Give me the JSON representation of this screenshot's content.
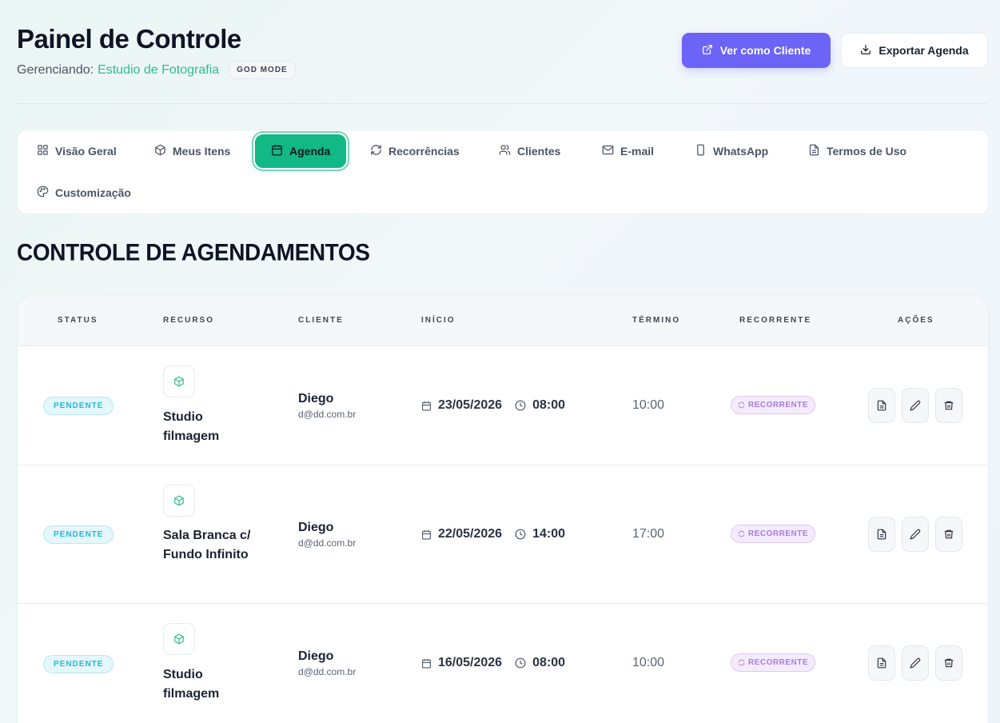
{
  "header": {
    "title": "Painel de Controle",
    "managing_label": "Gerenciando:",
    "studio_name": "Estudio de Fotografia",
    "mode_badge": "GOD MODE"
  },
  "actions": {
    "view_as_client": "Ver como Cliente",
    "export_schedule": "Exportar Agenda"
  },
  "tabs": [
    {
      "label": "Visão Geral",
      "icon": "grid-icon"
    },
    {
      "label": "Meus Itens",
      "icon": "box-icon"
    },
    {
      "label": "Agenda",
      "icon": "calendar-icon",
      "active": true
    },
    {
      "label": "Recorrências",
      "icon": "refresh-icon"
    },
    {
      "label": "Clientes",
      "icon": "users-icon"
    },
    {
      "label": "E-mail",
      "icon": "mail-icon"
    },
    {
      "label": "WhatsApp",
      "icon": "phone-icon"
    },
    {
      "label": "Termos de Uso",
      "icon": "document-icon"
    },
    {
      "label": "Customização",
      "icon": "palette-icon"
    }
  ],
  "section_title": "CONTROLE DE AGENDAMENTOS",
  "table": {
    "headers": {
      "status": "STATUS",
      "resource": "RECURSO",
      "client": "CLIENTE",
      "start": "INÍCIO",
      "end": "TÉRMINO",
      "recurring": "RECORRENTE",
      "actions": "AÇÕES"
    },
    "rows": [
      {
        "status": "PENDENTE",
        "resource": "Studio filmagem",
        "client": "Diego",
        "email": "d@dd.com.br",
        "date": "23/05/2026",
        "time": "08:00",
        "end": "10:00",
        "recurring": "RECORRENTE"
      },
      {
        "status": "PENDENTE",
        "resource": "Sala Branca c/ Fundo Infinito",
        "client": "Diego",
        "email": "d@dd.com.br",
        "date": "22/05/2026",
        "time": "14:00",
        "end": "17:00",
        "recurring": "RECORRENTE"
      },
      {
        "status": "PENDENTE",
        "resource": "Studio filmagem",
        "client": "Diego",
        "email": "d@dd.com.br",
        "date": "16/05/2026",
        "time": "08:00",
        "end": "10:00",
        "recurring": "RECORRENTE"
      }
    ]
  },
  "colors": {
    "primary": "#6c63f7",
    "active_tab": "#12b886",
    "studio_name": "#2bbf8a",
    "pending": "#2ab7d6",
    "recurring": "#a87be6"
  }
}
